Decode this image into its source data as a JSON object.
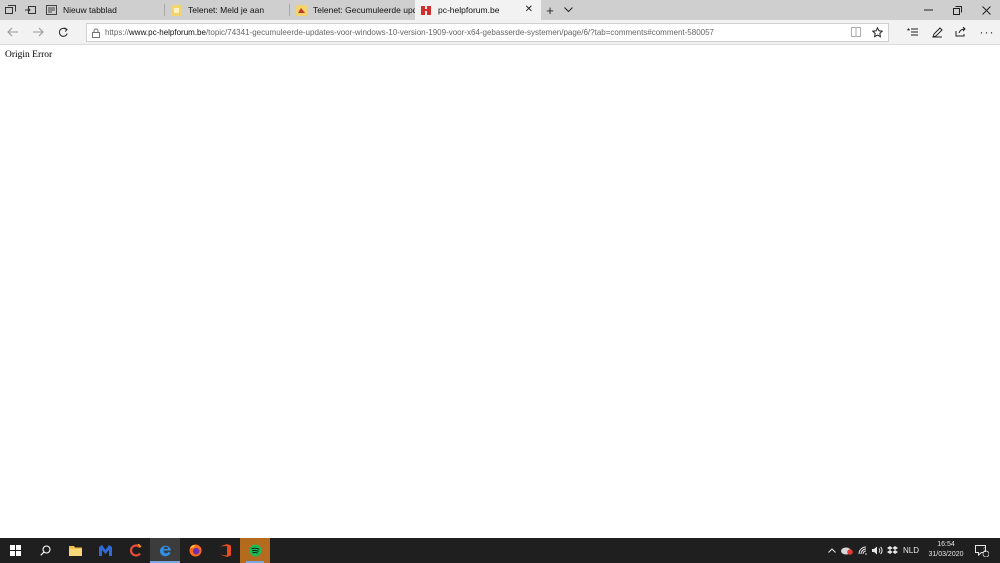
{
  "tabs": [
    {
      "label": "Nieuw tabblad",
      "icon": "new-tab-page-icon"
    },
    {
      "label": "Telenet: Meld je aan",
      "icon": "telenet-favicon"
    },
    {
      "label": "Telenet: Gecumuleerde upd",
      "icon": "telenet-favicon"
    },
    {
      "label": "pc-helpforum.be",
      "icon": "pc-helpforum-favicon",
      "active": true
    }
  ],
  "address": {
    "scheme": "https://",
    "host": "www.pc-helpforum.be",
    "path": "/topic/74341-gecumuleerde-updates-voor-windows-10-version-1909-voor-x64-gebasserde-systemen/page/6/?tab=comments#comment-580057"
  },
  "page": {
    "text": "Origin Error"
  },
  "tray": {
    "language": "NLD",
    "time": "16:54",
    "date": "31/03/2020",
    "notification_count": "2"
  },
  "colors": {
    "tabbar_bg": "#cfcfcf",
    "active_tab_bg": "#f2f2f2",
    "taskbar_bg": "#1f1f1f",
    "accent": "#7aa7e0"
  }
}
